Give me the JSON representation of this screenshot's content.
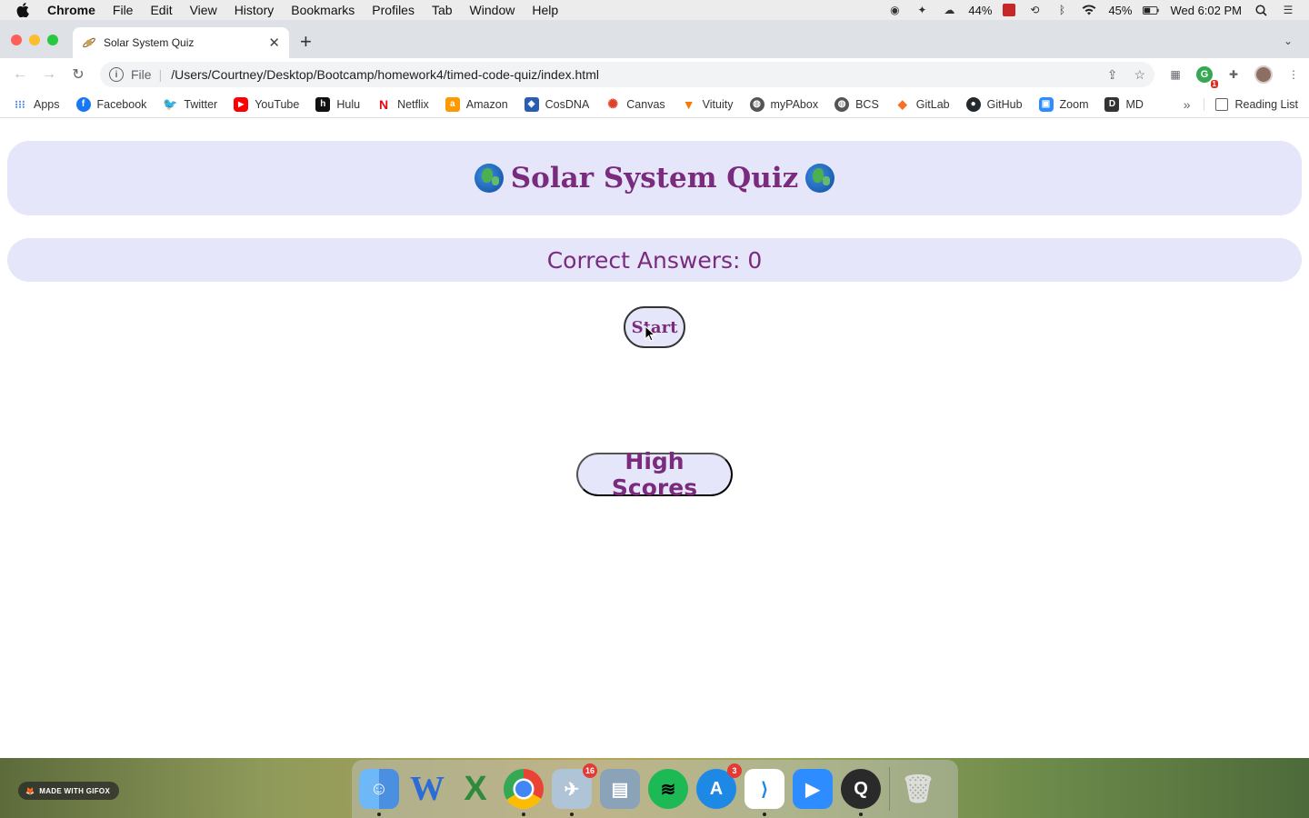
{
  "menubar": {
    "app_name": "Chrome",
    "items": [
      "File",
      "Edit",
      "View",
      "History",
      "Bookmarks",
      "Profiles",
      "Tab",
      "Window",
      "Help"
    ],
    "battery_left": "44%",
    "battery_right": "45%",
    "clock": "Wed 6:02 PM"
  },
  "browser": {
    "tab_title": "Solar System Quiz",
    "scheme": "File",
    "url": "/Users/Courtney/Desktop/Bootcamp/homework4/timed-code-quiz/index.html",
    "extension_badge": "1"
  },
  "bookmarks": {
    "items": [
      {
        "label": "Apps",
        "icon": "apps-grid-icon",
        "color": "#4285f4"
      },
      {
        "label": "Facebook",
        "icon": "facebook-icon",
        "color": "#1877f2"
      },
      {
        "label": "Twitter",
        "icon": "twitter-icon",
        "color": "#1da1f2"
      },
      {
        "label": "YouTube",
        "icon": "youtube-icon",
        "color": "#ff0000"
      },
      {
        "label": "Hulu",
        "icon": "hulu-icon",
        "color": "#111111"
      },
      {
        "label": "Netflix",
        "icon": "netflix-icon",
        "color": "#e50914"
      },
      {
        "label": "Amazon",
        "icon": "amazon-icon",
        "color": "#ff9900"
      },
      {
        "label": "CosDNA",
        "icon": "cosdna-icon",
        "color": "#2a5db0"
      },
      {
        "label": "Canvas",
        "icon": "canvas-icon",
        "color": "#e13f2b"
      },
      {
        "label": "Vituity",
        "icon": "vituity-icon",
        "color": "#f57c00"
      },
      {
        "label": "myPAbox",
        "icon": "globe-icon",
        "color": "#555555"
      },
      {
        "label": "BCS",
        "icon": "globe-icon",
        "color": "#555555"
      },
      {
        "label": "GitLab",
        "icon": "gitlab-icon",
        "color": "#fc6d26"
      },
      {
        "label": "GitHub",
        "icon": "github-icon",
        "color": "#24292e"
      },
      {
        "label": "Zoom",
        "icon": "zoom-icon",
        "color": "#2d8cff"
      },
      {
        "label": "MD",
        "icon": "md-icon",
        "color": "#333333"
      }
    ],
    "more": "»",
    "reading_list": "Reading List"
  },
  "page": {
    "title": "Solar System Quiz",
    "title_icon": "globe-icon",
    "score_label": "Correct Answers: 0",
    "start_label": "Start",
    "high_scores_label": "High Scores",
    "accent_color": "#7a2b7e",
    "panel_color": "#e6e6fa"
  },
  "desktop": {
    "gifox_label": "MADE WITH GIFOX",
    "dock_apps": [
      {
        "name": "Finder",
        "badge": ""
      },
      {
        "name": "Word",
        "badge": ""
      },
      {
        "name": "Excel",
        "badge": ""
      },
      {
        "name": "Chrome",
        "badge": ""
      },
      {
        "name": "Preview",
        "badge": "16"
      },
      {
        "name": "Photos",
        "badge": ""
      },
      {
        "name": "Spotify",
        "badge": ""
      },
      {
        "name": "App Store",
        "badge": "3"
      },
      {
        "name": "VS Code",
        "badge": ""
      },
      {
        "name": "Zoom",
        "badge": ""
      },
      {
        "name": "QuickTime",
        "badge": ""
      },
      {
        "name": "Trash",
        "badge": ""
      }
    ]
  }
}
